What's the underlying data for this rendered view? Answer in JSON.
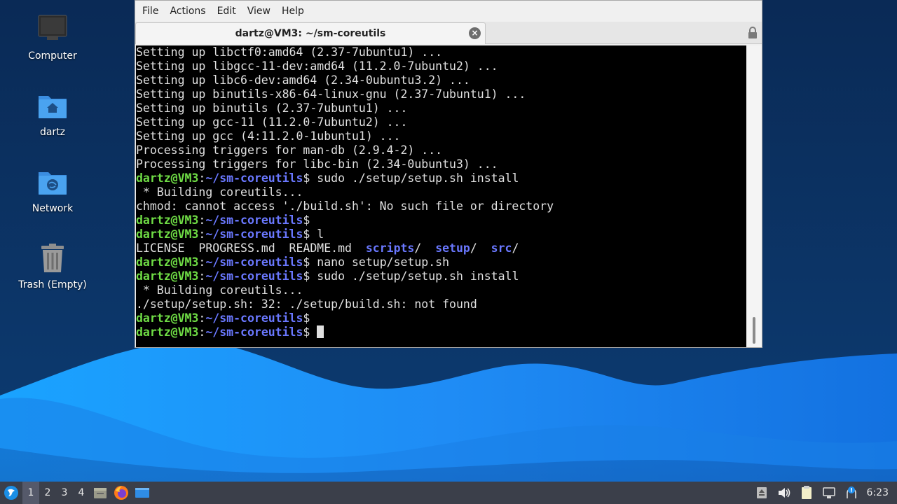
{
  "desktop": {
    "icons": [
      {
        "label": "Computer",
        "icon": "computer-icon"
      },
      {
        "label": "dartz",
        "icon": "home-folder-icon"
      },
      {
        "label": "Network",
        "icon": "network-folder-icon"
      },
      {
        "label": "Trash (Empty)",
        "icon": "trash-icon"
      }
    ]
  },
  "window": {
    "menu": [
      "File",
      "Actions",
      "Edit",
      "View",
      "Help"
    ],
    "tab_title": "dartz@VM3: ~/sm-coreutils",
    "tab_close_glyph": "×",
    "lock_icon": "lock-icon"
  },
  "terminal": {
    "prompt_user": "dartz@VM3",
    "prompt_colon": ":",
    "prompt_path": "~/sm-coreutils",
    "prompt_end": "$",
    "lines": {
      "l0": "Setting up libctf0:amd64 (2.37-7ubuntu1) ...",
      "l1": "Setting up libgcc-11-dev:amd64 (11.2.0-7ubuntu2) ...",
      "l2": "Setting up libc6-dev:amd64 (2.34-0ubuntu3.2) ...",
      "l3": "Setting up binutils-x86-64-linux-gnu (2.37-7ubuntu1) ...",
      "l4": "Setting up binutils (2.37-7ubuntu1) ...",
      "l5": "Setting up gcc-11 (11.2.0-7ubuntu2) ...",
      "l6": "Setting up gcc (4:11.2.0-1ubuntu1) ...",
      "l7": "Processing triggers for man-db (2.9.4-2) ...",
      "l8": "Processing triggers for libc-bin (2.34-0ubuntu3) ...",
      "c9": " sudo ./setup/setup.sh install",
      "l10": " * Building coreutils...",
      "l11": "chmod: cannot access './build.sh': No such file or directory",
      "c12": "",
      "c13": " l",
      "ls_files1": "LICENSE  PROGRESS.md  README.md  ",
      "ls_dir1": "scripts",
      "ls_sep1": "/  ",
      "ls_dir2": "setup",
      "ls_sep2": "/  ",
      "ls_dir3": "src",
      "ls_sep3": "/",
      "c15": " nano setup/setup.sh",
      "c16": " sudo ./setup/setup.sh install",
      "l17": " * Building coreutils...",
      "l18": "./setup/setup.sh: 32: ./setup/build.sh: not found",
      "c19": "",
      "c20": " "
    }
  },
  "taskbar": {
    "start_icon": "start-menu-icon",
    "workspaces": [
      "1",
      "2",
      "3",
      "4"
    ],
    "active_workspace": "1",
    "launchers": [
      "file-manager-icon",
      "firefox-icon",
      "show-desktop-icon"
    ],
    "tray": [
      "removable-media-icon",
      "volume-icon",
      "clipboard-icon",
      "network-icon",
      "update-notifier-icon"
    ],
    "clock": "6:23"
  },
  "colors": {
    "wallpaper_top": "#0a2a56",
    "wave_light": "#1f93ff",
    "wave_dark": "#0b3a6e",
    "prompt_user": "#6fdc45",
    "prompt_path": "#6a78ff",
    "taskbar": "#3b3f4a"
  }
}
